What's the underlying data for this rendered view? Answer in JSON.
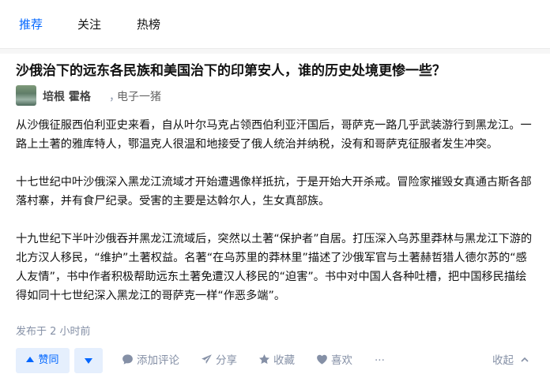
{
  "tabs": [
    {
      "label": "推荐",
      "active": true
    },
    {
      "label": "关注",
      "active": false
    },
    {
      "label": "热榜",
      "active": false
    }
  ],
  "question": {
    "title": "沙俄治下的远东各民族和美国治下的印第安人，谁的历史处境更惨一些？"
  },
  "author": {
    "name": "培根 霍格",
    "separator": "，",
    "headline": "电子一猪"
  },
  "answer": {
    "paragraphs": [
      "从沙俄征服西伯利亚史来看，自从叶尔马克占领西伯利亚汗国后，哥萨克一路几乎武装游行到黑龙江。一路上土著的雅库特人，鄂温克人很温和地接受了俄人统治并纳税，没有和哥萨克征服者发生冲突。",
      "十七世纪中叶沙俄深入黑龙江流域才开始遭遇像样抵抗，于是开始大开杀戒。冒险家摧毁女真通古斯各部落村寨，并有食尸纪录。受害的主要是达斡尔人，生女真部族。",
      "十九世纪下半叶沙俄吞并黑龙江流域后，突然以土著“保护者”自居。打压深入乌苏里莽林与黑龙江下游的北方汉人移民，“维护”土著权益。名著“在乌苏里的莽林里”描述了沙俄军官与土著赫哲猎人德尔苏的“感人友情”，书中作者积极帮助远东土著免遭汉人移民的“迫害”。书中对中国人各种吐槽，把中国移民描绘得如同十七世纪深入黑龙江的哥萨克一样“作恶多端”。"
    ],
    "time": "发布于 2 小时前"
  },
  "actions": {
    "upvote_label": "赞同",
    "comment_label": "添加评论",
    "share_label": "分享",
    "favorite_label": "收藏",
    "like_label": "喜欢",
    "more_label": "···",
    "collapse_label": "收起"
  },
  "colors": {
    "accent": "#0066ff",
    "muted": "#8590a6",
    "vote_bg": "#e5effd"
  }
}
